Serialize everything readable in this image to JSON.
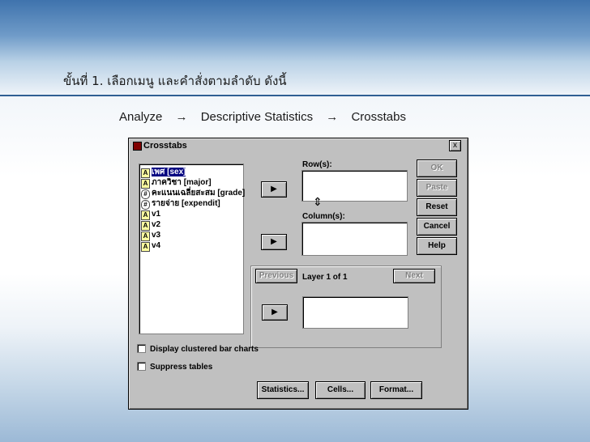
{
  "slide": {
    "title": "ขั้นที่ 1.  เลือกเมนู และคำสั่งตามลำดับ ดังนี้",
    "path": [
      "Analyze",
      "Descriptive Statistics",
      "Crosstabs"
    ],
    "arrow": "→"
  },
  "dialog": {
    "title": "Crosstabs",
    "close": "x",
    "variables": [
      {
        "label": "เพศ [sex]",
        "icon": "A",
        "kind": "string",
        "selected": true
      },
      {
        "label": "ภาควิชา [major]",
        "icon": "A",
        "kind": "string"
      },
      {
        "label": "คะแนนเฉลี่ยสะสม [grade]",
        "icon": "#",
        "kind": "scale"
      },
      {
        "label": "รายจ่าย [expendit]",
        "icon": "#",
        "kind": "scale"
      },
      {
        "label": "v1",
        "icon": "A",
        "kind": "string"
      },
      {
        "label": "v2",
        "icon": "A",
        "kind": "string"
      },
      {
        "label": "v3",
        "icon": "A",
        "kind": "string"
      },
      {
        "label": "v4",
        "icon": "A",
        "kind": "string"
      }
    ],
    "row_label": "Row(s):",
    "column_label": "Column(s):",
    "arrow_button": "▶",
    "buttons": {
      "ok": "OK",
      "paste": "Paste",
      "reset": "Reset",
      "cancel": "Cancel",
      "help": "Help"
    },
    "layer": {
      "previous": "Previous",
      "next": "Next",
      "label": "Layer 1 of 1"
    },
    "checks": {
      "clustered": "Display clustered bar charts",
      "suppress": "Suppress tables"
    },
    "bottom": {
      "statistics": "Statistics...",
      "cells": "Cells...",
      "format": "Format..."
    }
  }
}
